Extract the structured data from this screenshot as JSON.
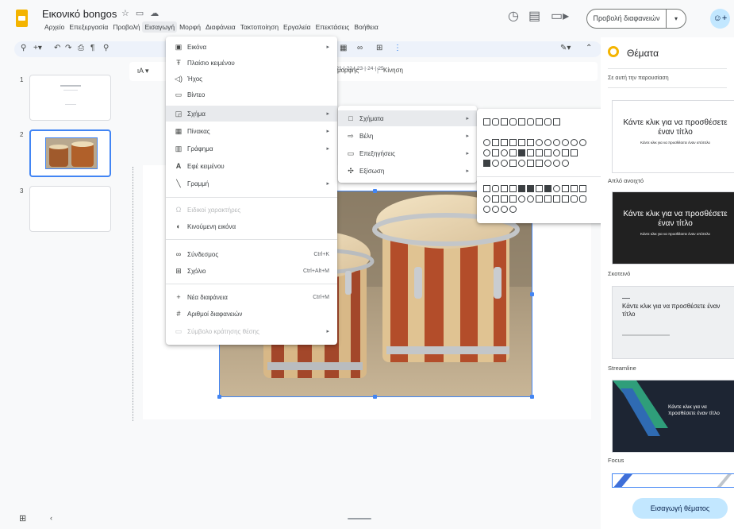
{
  "app": {
    "title": "Εικονικό bongos"
  },
  "menubar": [
    "Αρχείο",
    "Επεξεργασία",
    "Προβολή",
    "Εισαγωγή",
    "Μορφή",
    "Διαφάνεια",
    "Τακτοποίηση",
    "Εργαλεία",
    "Επεκτάσεις",
    "Βοήθεια"
  ],
  "header": {
    "present_label": "Προβολή διαφανειών"
  },
  "format_bar": {
    "format_label": "μορφής",
    "motion_label": "Κίνηση"
  },
  "ruler_top": "·16·|·17·|·18·|·19·|·20·|·21·|·22·|·23·|·24·|·25",
  "slides": [
    "1",
    "2",
    "3"
  ],
  "insert_menu": {
    "items": [
      {
        "icon": "image-icon",
        "glyph": "▣",
        "label": "Εικόνα",
        "arrow": "▸"
      },
      {
        "icon": "text-box-icon",
        "glyph": "Ŧ",
        "label": "Πλαίσιο κειμένου"
      },
      {
        "icon": "audio-icon",
        "glyph": "◁)",
        "label": "Ήχος"
      },
      {
        "icon": "video-icon",
        "glyph": "▭",
        "label": "Βίντεο"
      },
      {
        "icon": "shape-icon",
        "glyph": "◲",
        "label": "Σχήμα",
        "arrow": "▸"
      },
      {
        "icon": "table-icon",
        "glyph": "▦",
        "label": "Πίνακας",
        "arrow": "▸"
      },
      {
        "icon": "chart-icon",
        "glyph": "▥",
        "label": "Γράφημα",
        "arrow": "▸"
      },
      {
        "icon": "word-art-icon",
        "glyph": "A",
        "label": "Εφέ κειμένου"
      },
      {
        "icon": "line-icon",
        "glyph": "╲",
        "label": "Γραμμή",
        "arrow": "▸"
      },
      {
        "icon": "special-chars-icon",
        "glyph": "Ω",
        "label": "Ειδικοί χαρακτήρες"
      },
      {
        "icon": "animation-icon",
        "glyph": "◐",
        "label": "Κινούμενη εικόνα"
      },
      {
        "icon": "link-icon",
        "glyph": "∞",
        "label": "Σύνδεσμος",
        "shortcut": "Ctrl+K"
      },
      {
        "icon": "comment-icon",
        "glyph": "⊞",
        "label": "Σχόλιο",
        "shortcut": "Ctrl+Alt+M"
      },
      {
        "icon": "plus-icon",
        "glyph": "+",
        "label": "Νέα διαφάνεια",
        "shortcut": "Ctrl+M"
      },
      {
        "icon": "hash-icon",
        "glyph": "#",
        "label": "Αριθμοί διαφανειών"
      },
      {
        "icon": "placeholder-icon",
        "glyph": "▭",
        "label": "Σύμβολο κράτησης θέσης",
        "arrow": "▸"
      }
    ]
  },
  "shape_submenu": {
    "items": [
      {
        "icon": "square-icon",
        "glyph": "□",
        "label": "Σχήματα",
        "arrow": "▸"
      },
      {
        "icon": "arrow-icon",
        "glyph": "⇨",
        "label": "Βέλη",
        "arrow": "▸"
      },
      {
        "icon": "callout-icon",
        "glyph": "▭",
        "label": "Επεξηγήσεις",
        "arrow": "▸"
      },
      {
        "icon": "equation-icon",
        "glyph": "✣",
        "label": "Εξίσωση",
        "arrow": "▸"
      }
    ]
  },
  "themes": {
    "title": "Θέματα",
    "subtitle": "Σε αυτή την παρουσίαση",
    "cards": [
      {
        "name": "Απλό ανοιχτό",
        "title": "Κάντε κλικ για να προσθέσετε έναν τίτλο",
        "sub": "Κάντε κλικ για να προσθέσετε έναν υπότιτλο",
        "bg": "#ffffff",
        "fg": "#202124"
      },
      {
        "name": "Σκοτεινό",
        "title": "Κάντε κλικ για να προσθέσετε έναν τίτλο",
        "sub": "Κάντε κλικ για να προσθέσετε έναν υπότιτλο",
        "bg": "#212121",
        "fg": "#ffffff"
      },
      {
        "name": "Streamline",
        "title": "Κάντε κλικ για να προσθέσετε έναν τίτλο",
        "sub": "",
        "bg": "#eef0f2",
        "fg": "#202124"
      },
      {
        "name": "Focus",
        "title": "Κάντε κλικ για να προσθέσετε έναν τίτλο",
        "sub": "",
        "bg": "#1d2533",
        "fg": "#ffffff"
      }
    ],
    "import_label": "Εισαγωγή θέματος"
  },
  "colors": {
    "accent": "#4285f4",
    "logo": "#f4b400",
    "share": "#c2e7ff"
  }
}
